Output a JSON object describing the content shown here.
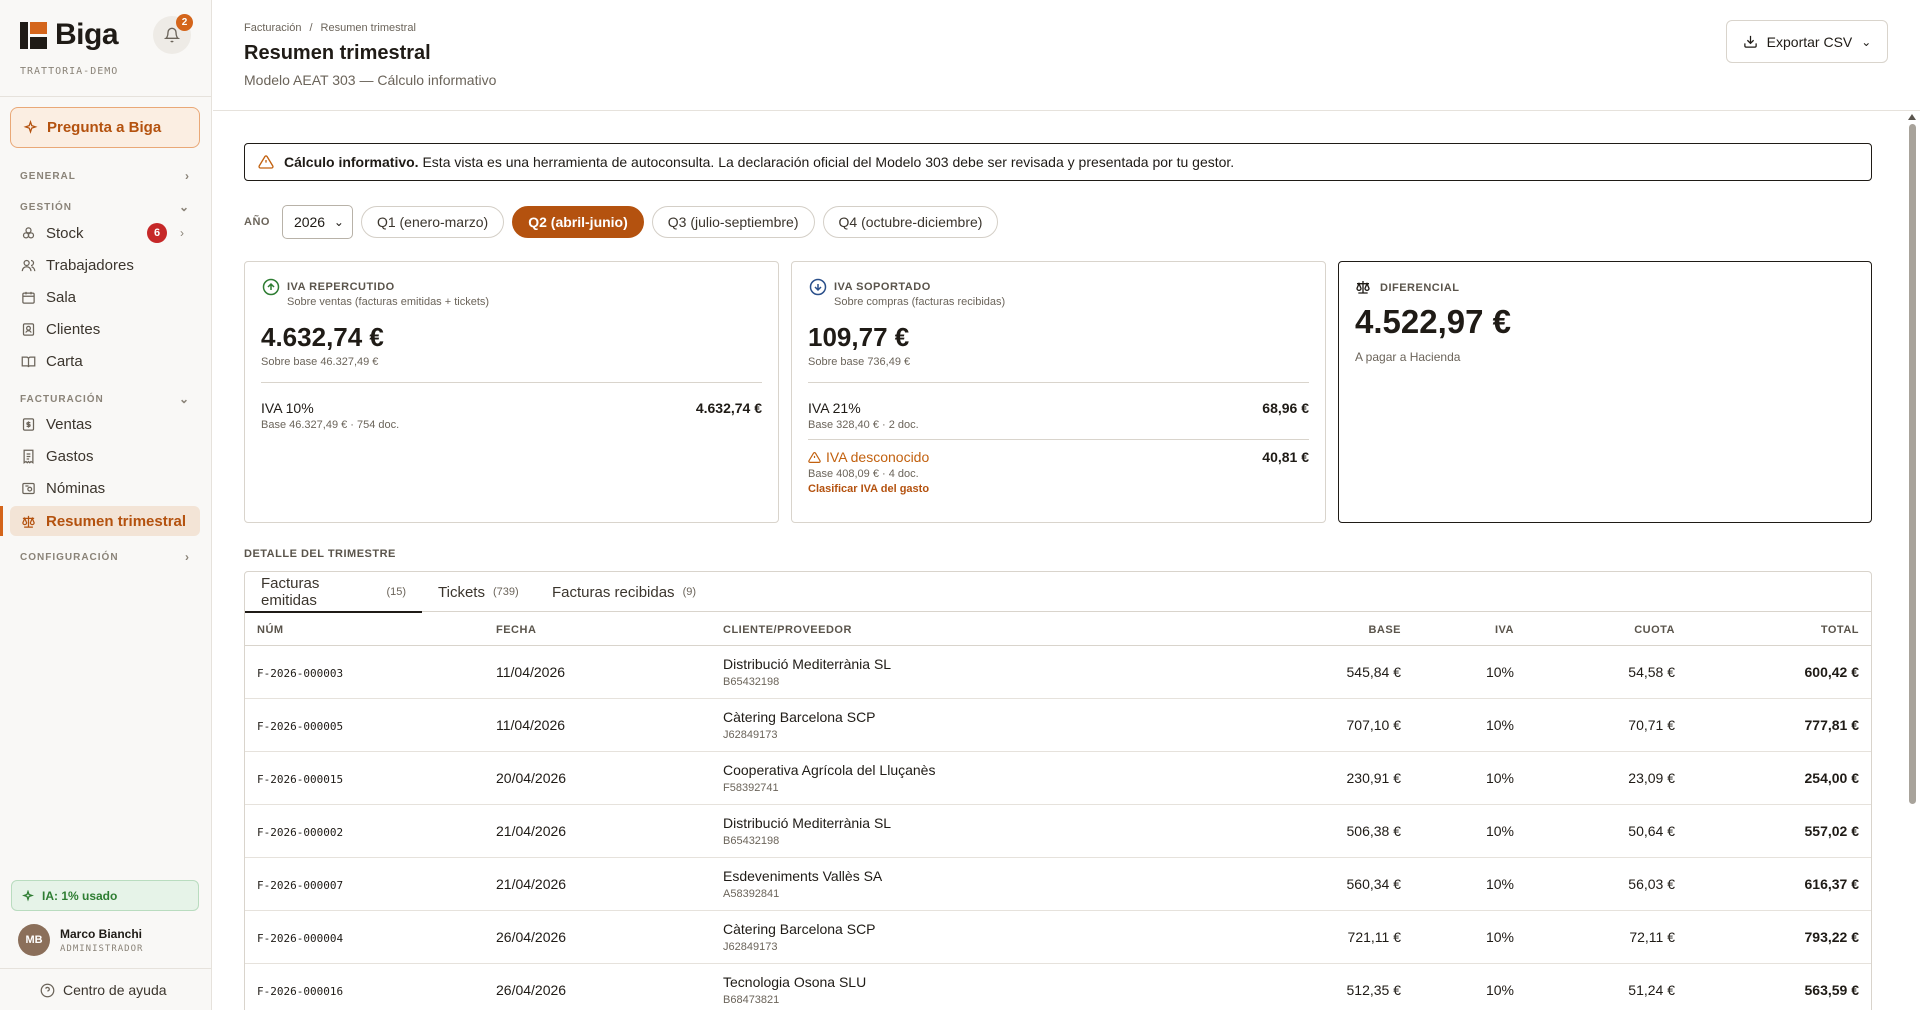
{
  "sidebar": {
    "logo": "Biga",
    "tenant": "TRATTORIA-DEMO",
    "notifications": "2",
    "ask_button": "Pregunta a Biga",
    "sections": {
      "general": "GENERAL",
      "gestion": "GESTIÓN",
      "facturacion": "FACTURACIÓN",
      "configuracion": "CONFIGURACIÓN"
    },
    "gestion_items": [
      {
        "label": "Stock",
        "badge": "6",
        "icon": "cubes-icon"
      },
      {
        "label": "Trabajadores",
        "icon": "users-icon"
      },
      {
        "label": "Sala",
        "icon": "calendar-icon"
      },
      {
        "label": "Clientes",
        "icon": "contact-icon"
      },
      {
        "label": "Carta",
        "icon": "book-icon"
      }
    ],
    "facturacion_items": [
      {
        "label": "Ventas",
        "icon": "dollar-doc-icon"
      },
      {
        "label": "Gastos",
        "icon": "receipt-icon"
      },
      {
        "label": "Nóminas",
        "icon": "payslip-icon"
      },
      {
        "label": "Resumen trimestral",
        "icon": "scale-icon",
        "active": true
      }
    ],
    "ia_usage": "IA: 1% usado",
    "user": {
      "initials": "MB",
      "name": "Marco Bianchi",
      "role": "ADMINISTRADOR"
    },
    "help": "Centro de ayuda"
  },
  "header": {
    "breadcrumb": [
      "Facturación",
      "/",
      "Resumen trimestral"
    ],
    "title": "Resumen trimestral",
    "subtitle": "Modelo AEAT 303 — Cálculo informativo",
    "export_label": "Exportar CSV"
  },
  "alert": {
    "bold": "Cálculo informativo.",
    "text": "Esta vista es una herramienta de autoconsulta. La declaración oficial del Modelo 303 debe ser revisada y presentada por tu gestor."
  },
  "filter": {
    "year_label": "AÑO",
    "year": "2026",
    "quarters": [
      "Q1 (enero-marzo)",
      "Q2 (abril-junio)",
      "Q3 (julio-septiembre)",
      "Q4 (octubre-diciembre)"
    ],
    "active_quarter": 1
  },
  "cards": {
    "repercutido": {
      "label": "IVA REPERCUTIDO",
      "desc": "Sobre ventas (facturas emitidas + tickets)",
      "amount": "4.632,74 €",
      "base": "Sobre base 46.327,49 €",
      "rows": [
        {
          "name": "IVA 10%",
          "value": "4.632,74 €",
          "sub": "Base 46.327,49 € · 754 doc."
        }
      ]
    },
    "soportado": {
      "label": "IVA SOPORTADO",
      "desc": "Sobre compras (facturas recibidas)",
      "amount": "109,77 €",
      "base": "Sobre base 736,49 €",
      "rows": [
        {
          "name": "IVA 21%",
          "value": "68,96 €",
          "sub": "Base 328,40 € · 2 doc."
        },
        {
          "name": "IVA desconocido",
          "value": "40,81 €",
          "sub": "Base 408,09 € · 4 doc.",
          "link": "Clasificar IVA del gasto"
        }
      ]
    },
    "diferencial": {
      "label": "DIFERENCIAL",
      "amount": "4.522,97 €",
      "note": "A pagar a Hacienda"
    }
  },
  "detail": {
    "title": "DETALLE DEL TRIMESTRE",
    "tabs": [
      {
        "label": "Facturas emitidas",
        "count": "(15)"
      },
      {
        "label": "Tickets",
        "count": "(739)"
      },
      {
        "label": "Facturas recibidas",
        "count": "(9)"
      }
    ],
    "columns": [
      "NÚM",
      "FECHA",
      "CLIENTE/PROVEEDOR",
      "BASE",
      "IVA",
      "CUOTA",
      "TOTAL"
    ],
    "rows": [
      {
        "num": "F-2026-000003",
        "fecha": "11/04/2026",
        "cliente": "Distribució Mediterrània SL",
        "nif": "B65432198",
        "base": "545,84 €",
        "iva": "10%",
        "cuota": "54,58 €",
        "total": "600,42 €"
      },
      {
        "num": "F-2026-000005",
        "fecha": "11/04/2026",
        "cliente": "Càtering Barcelona SCP",
        "nif": "J62849173",
        "base": "707,10 €",
        "iva": "10%",
        "cuota": "70,71 €",
        "total": "777,81 €"
      },
      {
        "num": "F-2026-000015",
        "fecha": "20/04/2026",
        "cliente": "Cooperativa Agrícola del Lluçanès",
        "nif": "F58392741",
        "base": "230,91 €",
        "iva": "10%",
        "cuota": "23,09 €",
        "total": "254,00 €"
      },
      {
        "num": "F-2026-000002",
        "fecha": "21/04/2026",
        "cliente": "Distribució Mediterrània SL",
        "nif": "B65432198",
        "base": "506,38 €",
        "iva": "10%",
        "cuota": "50,64 €",
        "total": "557,02 €"
      },
      {
        "num": "F-2026-000007",
        "fecha": "21/04/2026",
        "cliente": "Esdeveniments Vallès SA",
        "nif": "A58392841",
        "base": "560,34 €",
        "iva": "10%",
        "cuota": "56,03 €",
        "total": "616,37 €"
      },
      {
        "num": "F-2026-000004",
        "fecha": "26/04/2026",
        "cliente": "Càtering Barcelona SCP",
        "nif": "J62849173",
        "base": "721,11 €",
        "iva": "10%",
        "cuota": "72,11 €",
        "total": "793,22 €"
      },
      {
        "num": "F-2026-000016",
        "fecha": "26/04/2026",
        "cliente": "Tecnologia Osona SLU",
        "nif": "B68473821",
        "base": "512,35 €",
        "iva": "10%",
        "cuota": "51,24 €",
        "total": "563,59 €"
      }
    ]
  },
  "colors": {
    "accent": "#b4520f",
    "brand": "#d4651b",
    "warning": "#c2610f",
    "success": "#2e7d32",
    "danger": "#c62828"
  }
}
